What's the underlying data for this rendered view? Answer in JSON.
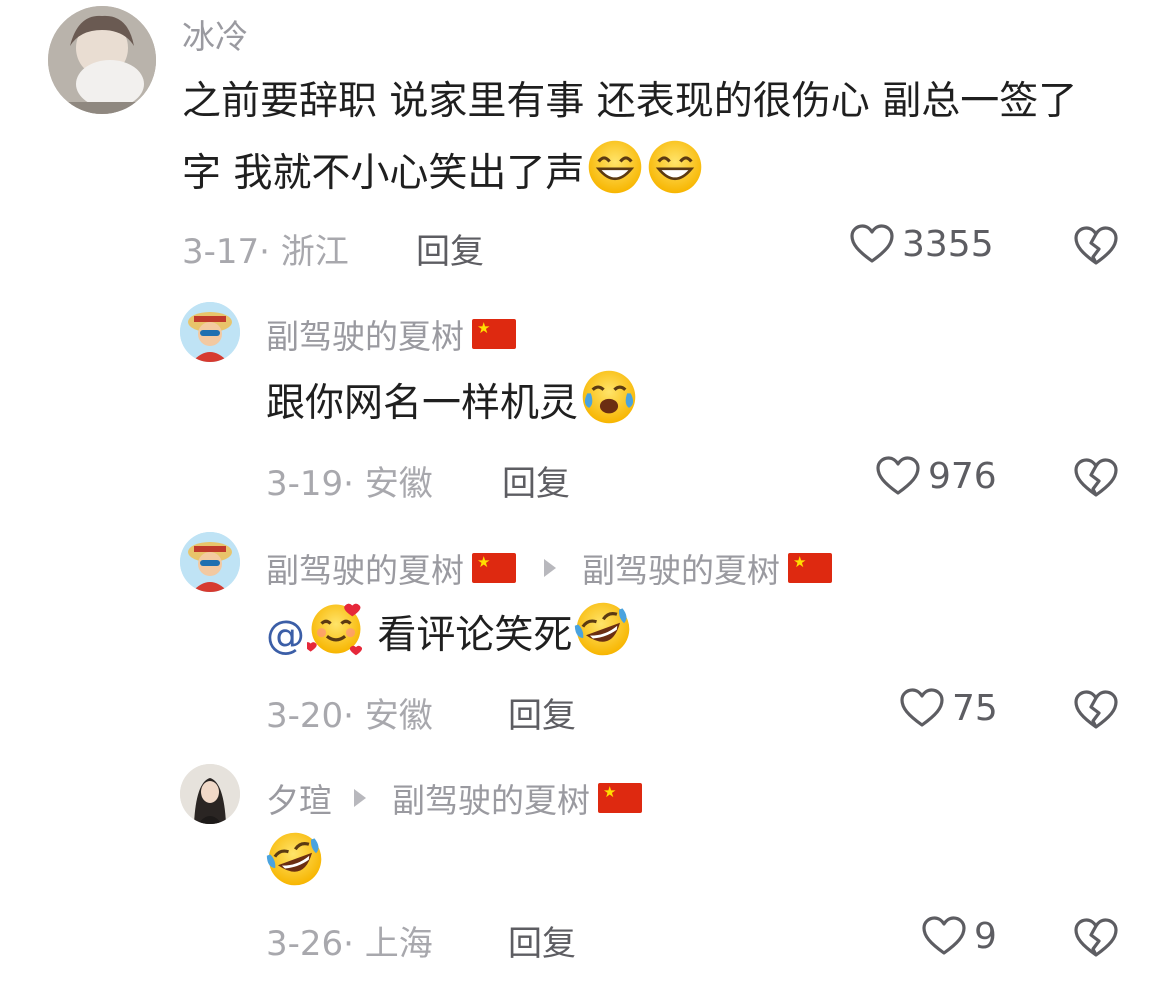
{
  "comments": [
    {
      "username": "冰冷",
      "text": "之前要辞职 说家里有事 还表现的很伤心 副总一签了字 我就不小心笑出了声",
      "date": "3-17",
      "location": "浙江",
      "reply_label": "回复",
      "likes": "3355",
      "emojis": [
        "grin-emoji",
        "grin-emoji"
      ]
    },
    {
      "username": "副驾驶的夏树",
      "text": "跟你网名一样机灵",
      "date": "3-19",
      "location": "安徽",
      "reply_label": "回复",
      "likes": "976",
      "emojis": [
        "crying-laughing-emoji"
      ]
    },
    {
      "username": "副驾驶的夏树",
      "reply_to": "副驾驶的夏树",
      "mention": "@",
      "text": "看评论笑死",
      "date": "3-20",
      "location": "安徽",
      "reply_label": "回复",
      "likes": "75",
      "emojis": [
        "smiling-hearts-emoji",
        "rolling-laughing-emoji"
      ]
    },
    {
      "username": "夕瑄",
      "reply_to": "副驾驶的夏树",
      "text": "",
      "date": "3-26",
      "location": "上海",
      "reply_label": "回复",
      "likes": "9",
      "emojis": [
        "rolling-laughing-emoji"
      ]
    }
  ],
  "colors": {
    "username": "#9a9aa0",
    "meta": "#a8a8ad",
    "action": "#5d5d62",
    "mention": "#3b5ea7"
  }
}
